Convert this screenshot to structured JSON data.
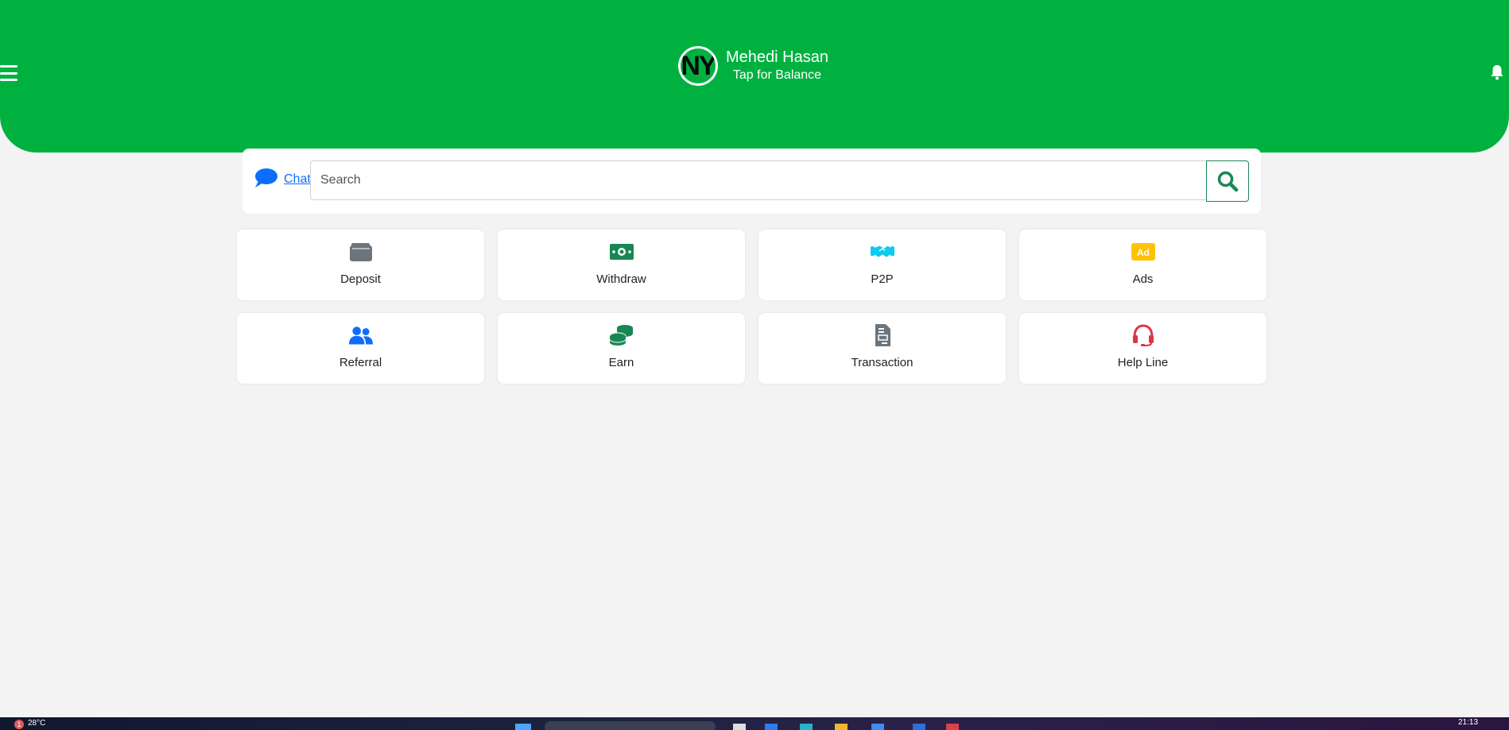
{
  "header": {
    "name": "Mehedi Hasan",
    "subtitle": "Tap for Balance",
    "avatar_text": "NY",
    "bg_color": "#00b140"
  },
  "search": {
    "chat_label": "Chat",
    "placeholder": "Search"
  },
  "tiles": [
    {
      "label": "Deposit",
      "icon": "wallet-icon",
      "color": "#6c757d"
    },
    {
      "label": "Withdraw",
      "icon": "money-bill-icon",
      "color": "#198754"
    },
    {
      "label": "P2P",
      "icon": "handshake-icon",
      "color": "#0dcaf0"
    },
    {
      "label": "Ads",
      "icon": "ad-icon",
      "color": "#ffc107"
    },
    {
      "label": "Referral",
      "icon": "users-icon",
      "color": "#0d6efd"
    },
    {
      "label": "Earn",
      "icon": "coins-icon",
      "color": "#198754"
    },
    {
      "label": "Transaction",
      "icon": "file-invoice-icon",
      "color": "#6c757d"
    },
    {
      "label": "Help Line",
      "icon": "headset-icon",
      "color": "#dc3545"
    }
  ],
  "taskbar": {
    "notification_count": "1",
    "temperature": "28°C",
    "time": "21:13"
  }
}
